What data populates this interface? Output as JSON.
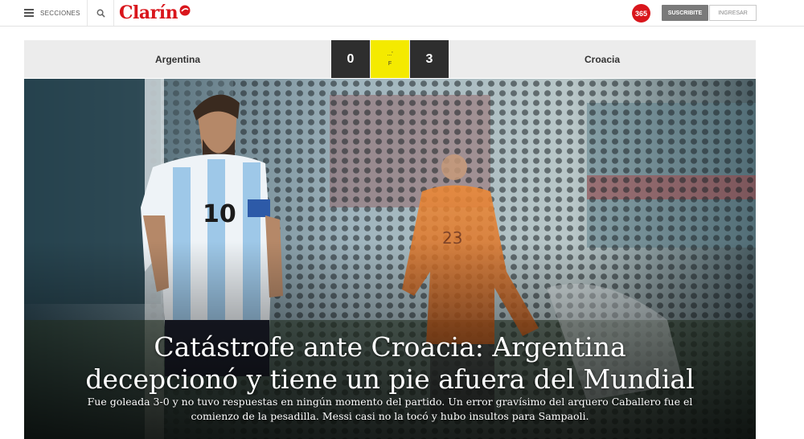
{
  "header": {
    "menu_label": "SECCIONES",
    "logo_text": "Clarín",
    "badge_365": "365",
    "subscribe_label": "SUSCRIBITE",
    "login_label": "INGRESAR",
    "brand_color": "#d9161c",
    "icons": [
      "menu-icon",
      "search-icon",
      "logo-mark-icon"
    ]
  },
  "scoreboard": {
    "home_team": "Argentina",
    "home_score": "0",
    "away_team": "Croacia",
    "away_score": "3",
    "status_top": "...'",
    "status_bottom": "F",
    "status_color": "#f4ea00"
  },
  "hero": {
    "headline_line1": "Catástrofe ante Croacia: Argentina",
    "headline_line2": "decepcionó y tiene un pie afuera del Mundial",
    "summary_line1": "Fue goleada 3-0 y no tuvo respuestas en ningún momento del partido. Un error gravísimo del arquero Caballero fue el",
    "summary_line2": "comienzo de la pesadilla. Messi casi no la tocó y hubo insultos para Sampaoli.",
    "jersey_number": "10",
    "keeper_number": "23"
  }
}
